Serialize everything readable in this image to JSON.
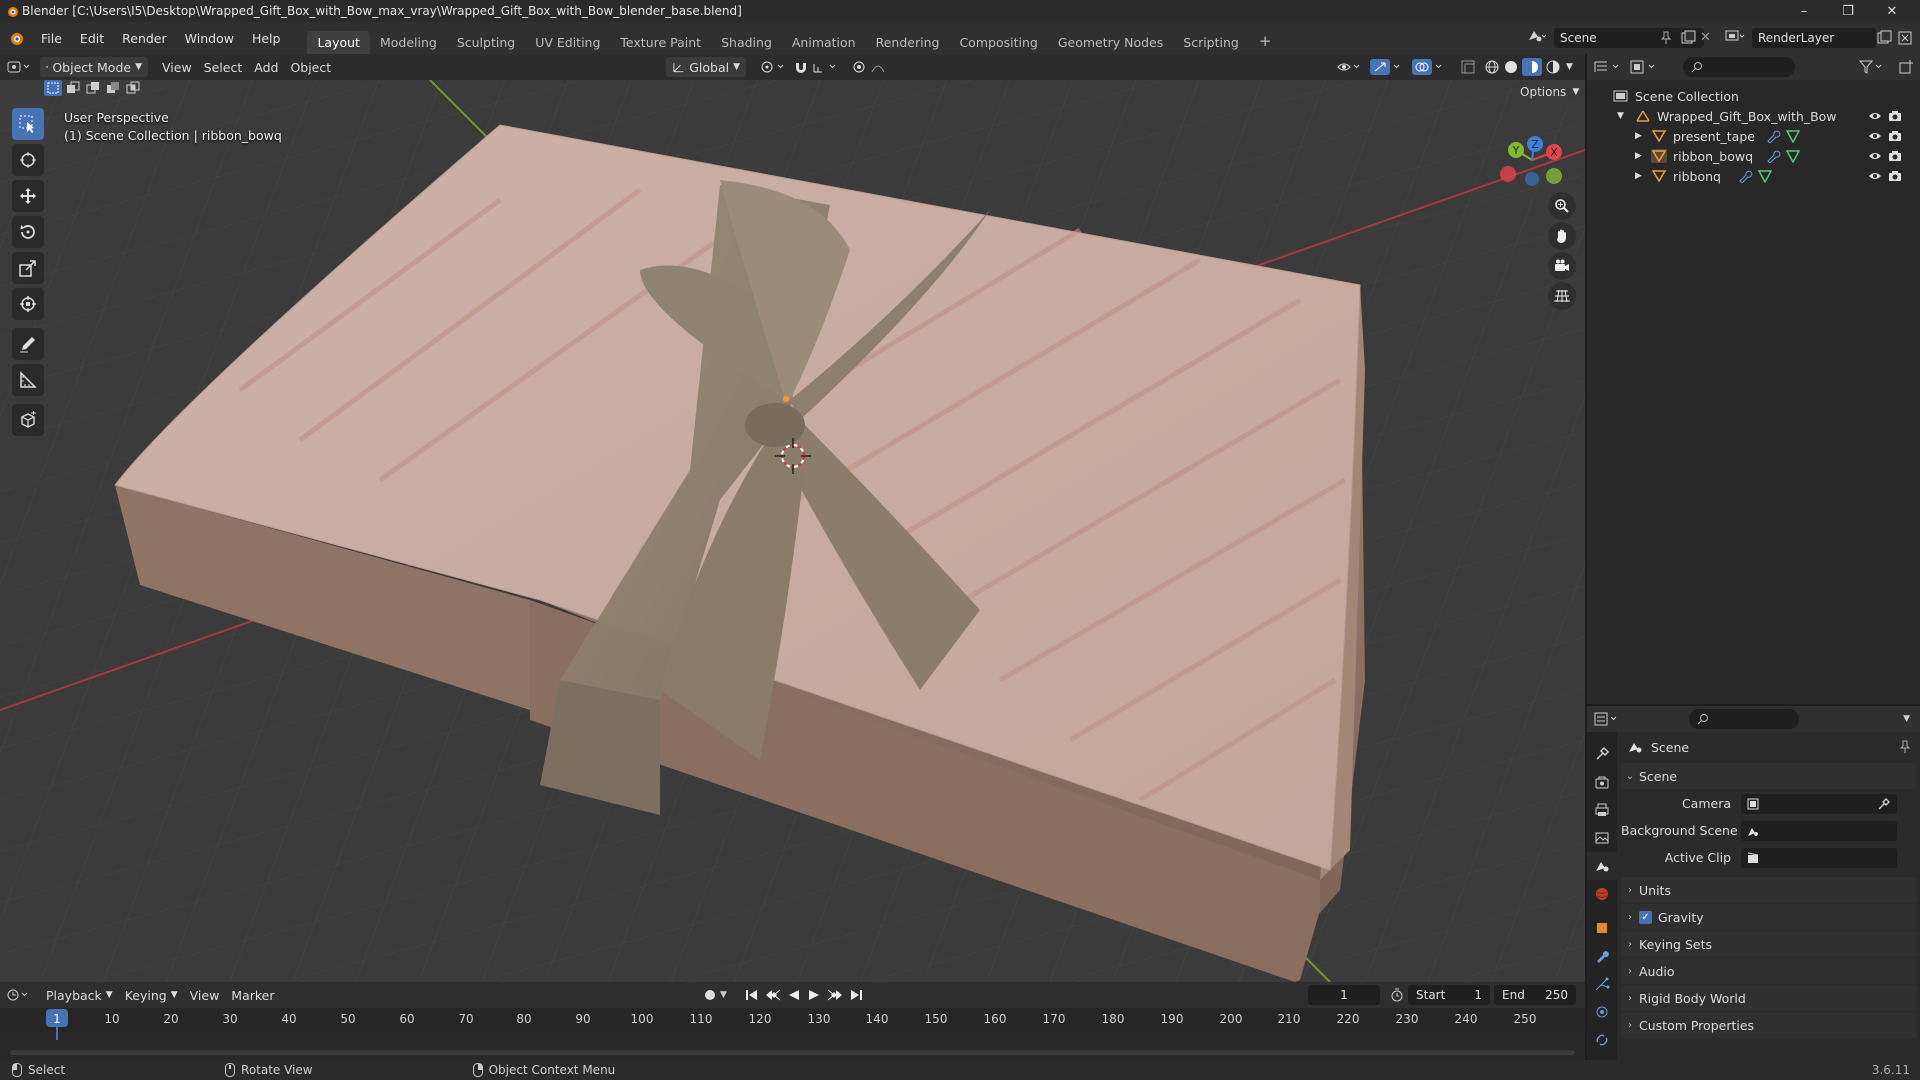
{
  "window": {
    "title": "Blender [C:\\Users\\I5\\Desktop\\Wrapped_Gift_Box_with_Bow_max_vray\\Wrapped_Gift_Box_with_Bow_blender_base.blend]"
  },
  "menu": [
    "File",
    "Edit",
    "Render",
    "Window",
    "Help"
  ],
  "workspaces": [
    "Layout",
    "Modeling",
    "Sculpting",
    "UV Editing",
    "Texture Paint",
    "Shading",
    "Animation",
    "Rendering",
    "Compositing",
    "Geometry Nodes",
    "Scripting"
  ],
  "active_workspace": "Layout",
  "scene_name": "Scene",
  "view_layer": "RenderLayer",
  "viewport_header": {
    "mode": "Object Mode",
    "menus": [
      "View",
      "Select",
      "Add",
      "Object"
    ],
    "orientation": "Global",
    "options": "Options"
  },
  "viewport": {
    "perspective": "User Perspective",
    "context": "(1) Scene Collection | ribbon_bowq"
  },
  "outliner": {
    "root": "Scene Collection",
    "collection": "Wrapped_Gift_Box_with_Bow",
    "objects": [
      "present_tape",
      "ribbon_bowq",
      "ribbonq"
    ]
  },
  "properties": {
    "context": "Scene",
    "panel": "Scene",
    "fields": {
      "camera_label": "Camera",
      "background_label": "Background Scene",
      "clip_label": "Active Clip"
    },
    "subpanels": [
      "Units",
      "Gravity",
      "Keying Sets",
      "Audio",
      "Rigid Body World",
      "Custom Properties"
    ],
    "gravity_checked": true
  },
  "timeline": {
    "menus": [
      "Playback",
      "Keying",
      "View",
      "Marker"
    ],
    "current_frame": "1",
    "start_label": "Start",
    "start": "1",
    "end_label": "End",
    "end": "250",
    "ticks": [
      "1",
      "10",
      "20",
      "30",
      "40",
      "50",
      "60",
      "70",
      "80",
      "90",
      "100",
      "110",
      "120",
      "130",
      "140",
      "150",
      "160",
      "170",
      "180",
      "190",
      "200",
      "210",
      "220",
      "230",
      "240",
      "250"
    ]
  },
  "statusbar": {
    "select": "Select",
    "rotate": "Rotate View",
    "context_menu": "Object Context Menu",
    "version": "3.6.11"
  },
  "colors": {
    "accent": "#4772b3",
    "x_axis": "#e2444b",
    "y_axis": "#84b833",
    "z_axis": "#3f7fe0",
    "gift_paper": "#c9aca2",
    "ribbon": "#8e8070"
  }
}
